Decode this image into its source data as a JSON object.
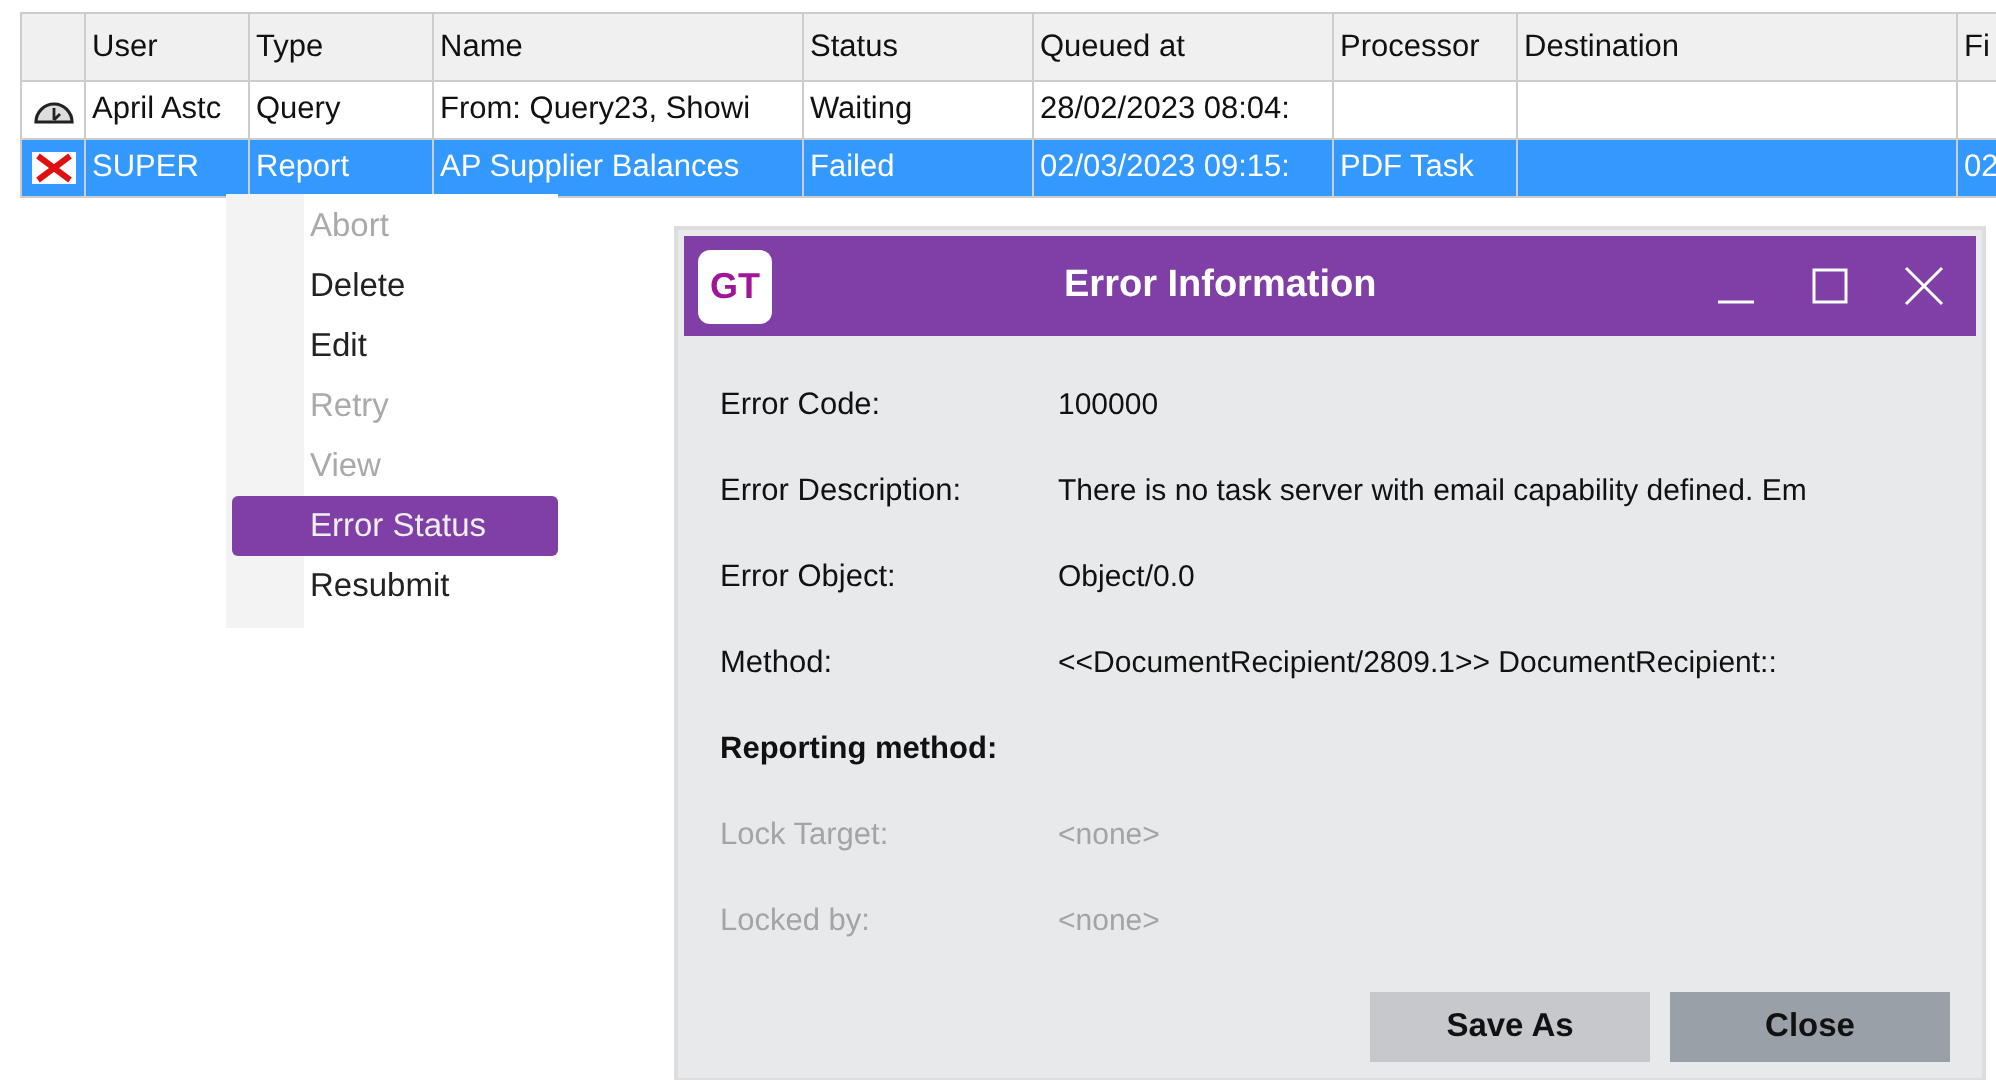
{
  "table": {
    "columns": [
      "User",
      "Type",
      "Name",
      "Status",
      "Queued at",
      "Processor",
      "Destination",
      "Fi"
    ],
    "rows": [
      {
        "kind": "waiting",
        "selected": false,
        "cells": [
          "April Astc",
          "Query",
          "From: Query23, Showi",
          "Waiting",
          "28/02/2023 08:04:",
          "",
          "",
          ""
        ]
      },
      {
        "kind": "failed",
        "selected": true,
        "cells": [
          "SUPER",
          "Report",
          "AP Supplier Balances",
          "Failed",
          "02/03/2023 09:15:",
          "PDF Task",
          "",
          "02"
        ]
      }
    ]
  },
  "context_menu": {
    "items": [
      {
        "label": "Abort",
        "disabled": true,
        "selected": false
      },
      {
        "label": "Delete",
        "disabled": false,
        "selected": false
      },
      {
        "label": "Edit",
        "disabled": false,
        "selected": false
      },
      {
        "label": "Retry",
        "disabled": true,
        "selected": false
      },
      {
        "label": "View",
        "disabled": true,
        "selected": false
      },
      {
        "label": "Error Status",
        "disabled": false,
        "selected": true
      },
      {
        "label": "Resubmit",
        "disabled": false,
        "selected": false
      }
    ]
  },
  "dialog": {
    "logo": "GT",
    "title": "Error Information",
    "fields": [
      {
        "label": "Error Code:",
        "value": "100000",
        "disabled": false,
        "bold": false
      },
      {
        "label": "Error Description:",
        "value": "There is no task server with email capability defined. Em",
        "disabled": false,
        "bold": false
      },
      {
        "label": "Error Object:",
        "value": "Object/0.0",
        "disabled": false,
        "bold": false
      },
      {
        "label": "Method:",
        "value": "<<DocumentRecipient/2809.1>> DocumentRecipient::",
        "disabled": false,
        "bold": false
      },
      {
        "label": "Reporting method:",
        "disabled": false,
        "bold": true
      },
      {
        "label": "Lock Target:",
        "value": "<none>",
        "disabled": true,
        "bold": false
      },
      {
        "label": "Locked by:",
        "value": "<none>",
        "disabled": true,
        "bold": false
      }
    ],
    "buttons": [
      "Save As",
      "Close"
    ]
  }
}
